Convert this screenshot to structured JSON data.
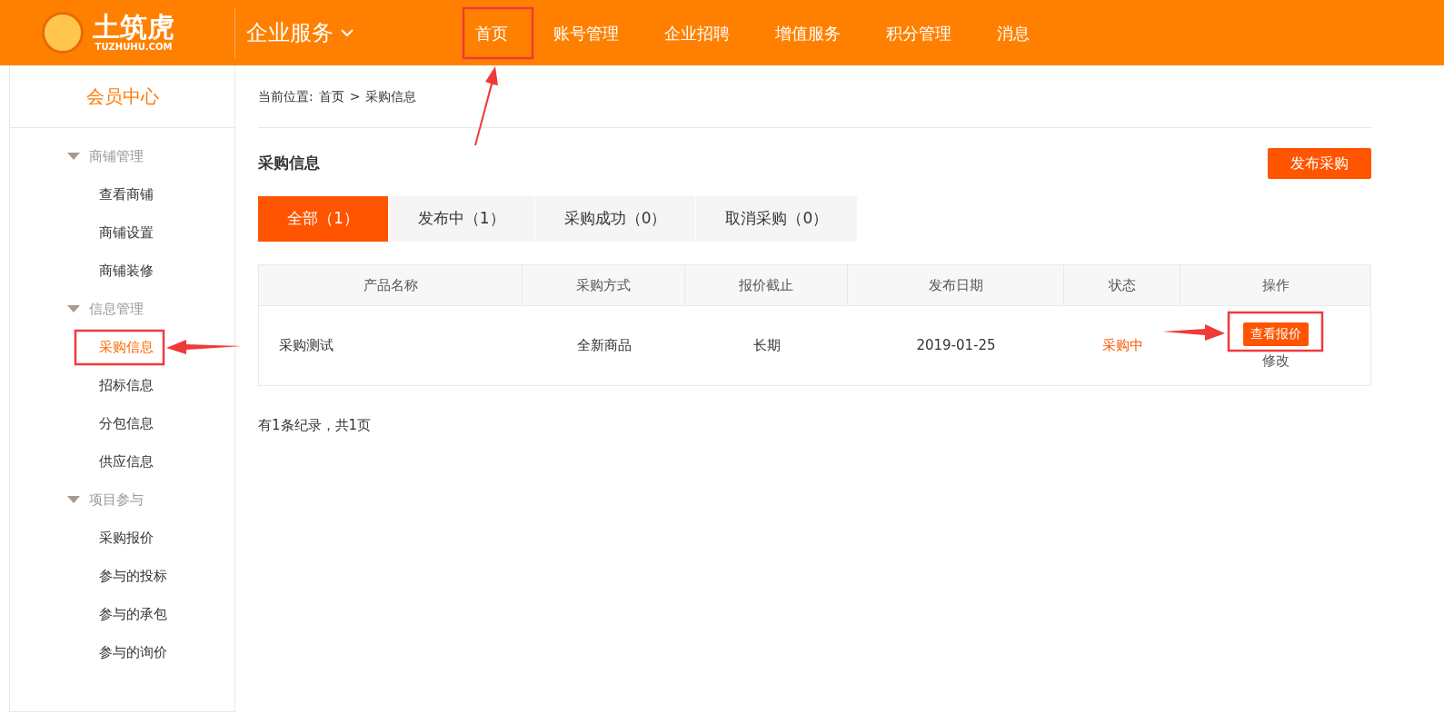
{
  "header": {
    "logo": {
      "name": "土筑虎",
      "domain": "TUZHUHU.COM"
    },
    "section": "企业服务",
    "nav": [
      "首页",
      "账号管理",
      "企业招聘",
      "增值服务",
      "积分管理",
      "消息"
    ]
  },
  "sidebar": {
    "title": "会员中心",
    "groups": [
      {
        "label": "商铺管理",
        "expanded": true,
        "children": [
          {
            "label": "查看商铺",
            "selected": false
          },
          {
            "label": "商铺设置",
            "selected": false
          },
          {
            "label": "商铺装修",
            "selected": false
          }
        ]
      },
      {
        "label": "信息管理",
        "expanded": true,
        "children": [
          {
            "label": "采购信息",
            "selected": true
          },
          {
            "label": "招标信息",
            "selected": false
          },
          {
            "label": "分包信息",
            "selected": false
          },
          {
            "label": "供应信息",
            "selected": false
          }
        ]
      },
      {
        "label": "项目参与",
        "expanded": true,
        "children": [
          {
            "label": "采购报价",
            "selected": false
          },
          {
            "label": "参与的投标",
            "selected": false
          },
          {
            "label": "参与的承包",
            "selected": false
          },
          {
            "label": "参与的询价",
            "selected": false
          }
        ]
      }
    ]
  },
  "breadcrumb": {
    "prefix": "当前位置:",
    "items": [
      "首页",
      "采购信息"
    ],
    "separator": ">"
  },
  "page_title": "采购信息",
  "publish_button": "发布采购",
  "tabs": [
    {
      "label": "全部（1）",
      "selected": true
    },
    {
      "label": "发布中（1）",
      "selected": false
    },
    {
      "label": "采购成功（0）",
      "selected": false
    },
    {
      "label": "取消采购（0）",
      "selected": false
    }
  ],
  "table": {
    "columns": [
      "产品名称",
      "采购方式",
      "报价截止",
      "发布日期",
      "状态",
      "操作"
    ],
    "rows": [
      {
        "name": "采购测试",
        "method": "全新商品",
        "deadline": "长期",
        "date": "2019-01-25",
        "status": "采购中",
        "actions": {
          "primary": "查看报价",
          "secondary": "修改"
        }
      }
    ]
  },
  "pagination": "有1条纪录，共1页"
}
